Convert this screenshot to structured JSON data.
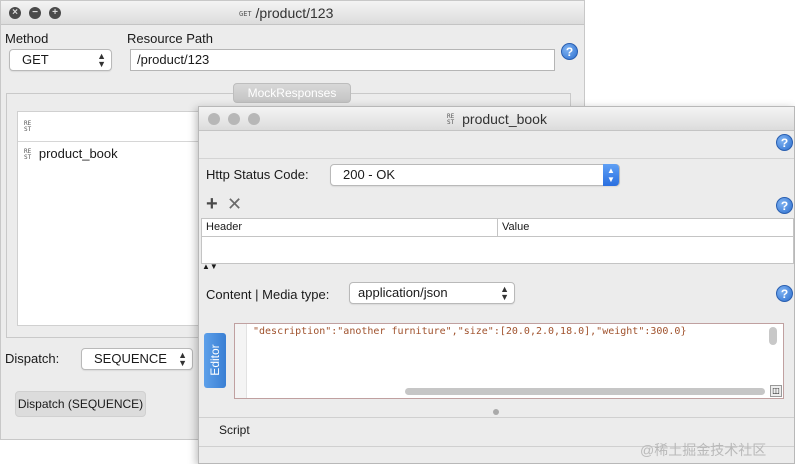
{
  "main_window": {
    "title": "/product/123",
    "method_label": "Method",
    "method_value": "GET",
    "resource_path_label": "Resource Path",
    "resource_path_value": "/product/123",
    "mock_responses_button": "MockResponses",
    "responses": [
      {
        "name": "product_book"
      }
    ],
    "dispatch_label": "Dispatch:",
    "dispatch_value": "SEQUENCE",
    "dispatch_button": "Dispatch (SEQUENCE)"
  },
  "response_window": {
    "title": "product_book",
    "http_status_label": "Http Status Code:",
    "http_status_value": "200 - OK",
    "headers_table": {
      "columns": [
        "Header",
        "Value"
      ]
    },
    "content_label": "Content | Media type:",
    "media_type_value": "application/json",
    "editor_tab": "Editor",
    "editor_content": "\"description\":\"another furniture\",\"size\":[20.0,2.0,18.0],\"weight\":300.0}",
    "script_tab": "Script"
  },
  "watermark": "@稀土掘金技术社区",
  "colors": {
    "window_bg": "#ececec",
    "help_blue": "#2d6fcf",
    "editor_tab_blue": "#4a90d9",
    "editor_text": "#a0522d"
  },
  "icons": [
    "close-icon",
    "minimize-icon",
    "zoom-icon",
    "rest-icon",
    "help-icon",
    "add-icon",
    "remove-icon",
    "chevron-updown-icon",
    "splitter-arrows-icon",
    "resize-grip-icon"
  ]
}
